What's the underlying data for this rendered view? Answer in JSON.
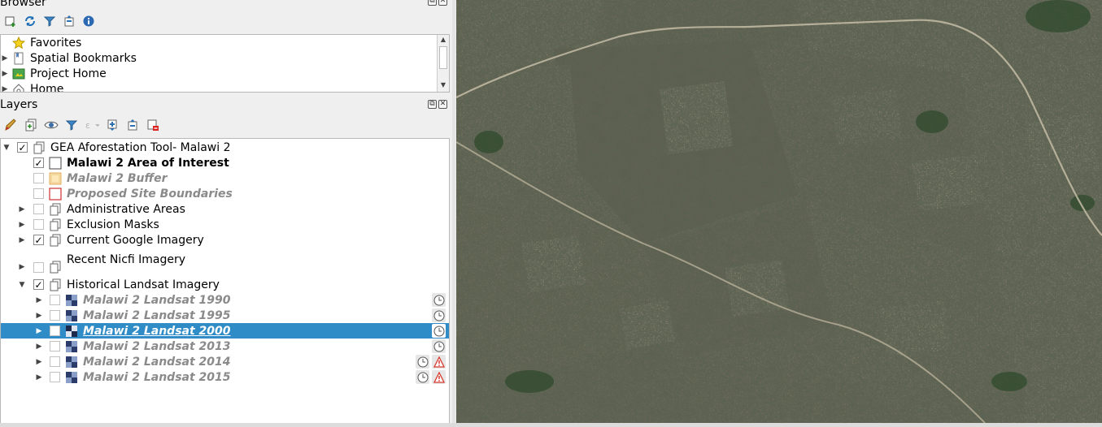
{
  "browser_panel": {
    "title": "Browser",
    "items": [
      {
        "label": "Favorites",
        "icon": "star-icon"
      },
      {
        "label": "Spatial Bookmarks",
        "icon": "bookmark-icon"
      },
      {
        "label": "Project Home",
        "icon": "project-home-icon"
      },
      {
        "label": "Home",
        "icon": "home-icon"
      }
    ]
  },
  "layers_panel": {
    "title": "Layers",
    "group_root": {
      "label": "GEA Aforestation Tool- Malawi 2",
      "checked": true
    },
    "layers": [
      {
        "label": "Malawi 2 Area of Interest",
        "checked": true,
        "style": "bold"
      },
      {
        "label": "Malawi 2 Buffer",
        "checked": false,
        "style": "dim"
      },
      {
        "label": "Proposed Site Boundaries",
        "checked": false,
        "style": "dim"
      },
      {
        "label": "Administrative Areas",
        "checked": false,
        "style": "group"
      },
      {
        "label": "Exclusion Masks",
        "checked": false,
        "style": "group"
      },
      {
        "label": "Current Google Imagery",
        "checked": true,
        "style": "group"
      },
      {
        "label": "Recent Nicfi Imagery",
        "checked": false,
        "style": "group"
      },
      {
        "label": "Historical Landsat Imagery",
        "checked": true,
        "style": "group"
      }
    ],
    "landsat_layers": [
      {
        "label": "Malawi 2 Landsat 1990",
        "warning": false,
        "selected": false
      },
      {
        "label": "Malawi 2 Landsat 1995",
        "warning": false,
        "selected": false
      },
      {
        "label": "Malawi 2 Landsat 2000",
        "warning": false,
        "selected": true
      },
      {
        "label": "Malawi 2 Landsat 2013",
        "warning": false,
        "selected": false
      },
      {
        "label": "Malawi 2 Landsat 2014",
        "warning": true,
        "selected": false
      },
      {
        "label": "Malawi 2 Landsat 2015",
        "warning": true,
        "selected": false
      }
    ]
  },
  "colors": {
    "selection": "#308cc6",
    "panel_bg": "#efefef",
    "warning": "#d83b2f"
  }
}
